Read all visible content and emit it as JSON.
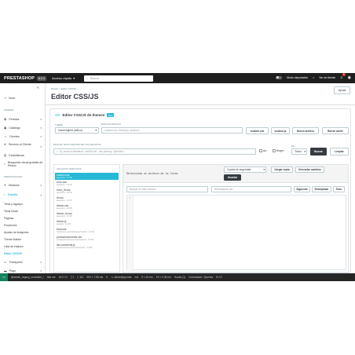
{
  "header": {
    "logo": "PRESTASHOP",
    "version": "8.2.0",
    "quick_access": "Acceso rápido",
    "search_placeholder": "Buscar",
    "debug_mode": "Modo depuración",
    "view_store": "Ver en tienda",
    "notifications_count": "1"
  },
  "sidebar": {
    "home": "Inicio",
    "sections": [
      {
        "title": "VENDER",
        "items": [
          "Pedidos",
          "Catálogo",
          "Clientes",
          "Servicio al Cliente",
          "Estadísticas",
          "Búsqueda visual gratuita de Rekviz"
        ]
      },
      {
        "title": "PERSONALIZAR",
        "items": [
          "Módulos",
          "Diseño"
        ]
      }
    ],
    "design_subitems": [
      "Tema y logotipo",
      "Tema Email",
      "Páginas",
      "Posiciones",
      "Ajustes de imágenes",
      "Theme Builder",
      "Lista de enlaces",
      "Editor CSS/JS"
    ],
    "active_subitem": "Editor CSS/JS",
    "after_items": [
      "Transporte",
      "Pago"
    ]
  },
  "breadcrumb": "Diseño  >  Editor CSS/JS",
  "page_title": "Editor CSS/JS",
  "help_button": "Ayuda",
  "card": {
    "title": "Editor CSS/JS de themes",
    "beta_badge": "Beta",
    "theme_label": "THEME",
    "theme_value": "hummingbird (activo)",
    "file_search_label": "BUSCAR ARCHIVO",
    "file_search_placeholder": "custom.css, theme.js, product...",
    "quick_buttons": [
      "custom.css",
      "custom.js",
      "Nuevo archivo",
      "Borrar caché"
    ],
    "content_search_label": "BUSCAR TEXTO DENTRO DE LOS ARCHIVOS",
    "content_search_placeholder": "Ej: product-miniature, addToCart, .btn-primary, @media...",
    "checkbox_aa": "Aa",
    "checkbox_regex": "Regex",
    "in_label": "EN",
    "in_value": "Todos",
    "search_button": "Buscar",
    "clear_button": "Limpiar",
    "files_header": "ARCHIVOS TEMÁTICOS",
    "files": [
      {
        "name": "custom.css",
        "meta": "assets/css · 0.0 KB"
      },
      {
        "name": "error.css",
        "meta": "assets/css · 0.0 KB"
      },
      {
        "name": "error_rtl.css",
        "meta": "assets/css · 0.0 KB"
      },
      {
        "name": "rtl.css",
        "meta": "assets/css · 0.0 KB"
      },
      {
        "name": "theme.css",
        "meta": "assets/css · 0.0 KB"
      },
      {
        "name": "theme_rtl.css",
        "meta": "assets/css · 0.0 KB"
      },
      {
        "name": "theme.js",
        "meta": "assets/js · 0.0 KB"
      },
      {
        "name": "front.css",
        "meta": "modules/ps_searchbar/views/css/front · 0.0 KB"
      },
      {
        "name": "productcomments.css",
        "meta": "modules/productcomments/views/css · 0.0 KB"
      },
      {
        "name": "list-comments.js",
        "meta": "modules/productcomments/views/js · 0.0 KB"
      }
    ],
    "editor_message": "Selecciona un archivo de la lista",
    "backup_select": "Copias de seguridad",
    "load_copy_button": "Cargar copia",
    "discard_button": "Descartar cambios",
    "save_button": "Guardar",
    "find_placeholder": "Buscar en este archivo",
    "replace_placeholder": "Reemplazar por",
    "replace_buttons": [
      "Siguiente",
      "Reemplazar",
      "Todo"
    ],
    "line_number": "1"
  },
  "statusbar": {
    "remote": "><",
    "path": "@admin_legacy_controller_/",
    "encoding": "Ask me",
    "time": "16.0 13",
    "n1": "1",
    "n2": "111",
    "mem": "392 × 7.55 ms",
    "n3": "0",
    "user": "admin@ps.test",
    "a": "n/a",
    "b": "9 × 40 ms",
    "c": "19 × 0.36 ms",
    "hooks": "Hooks (1)",
    "cmd": "Commands / Queries",
    "ver": "8.2.0"
  }
}
